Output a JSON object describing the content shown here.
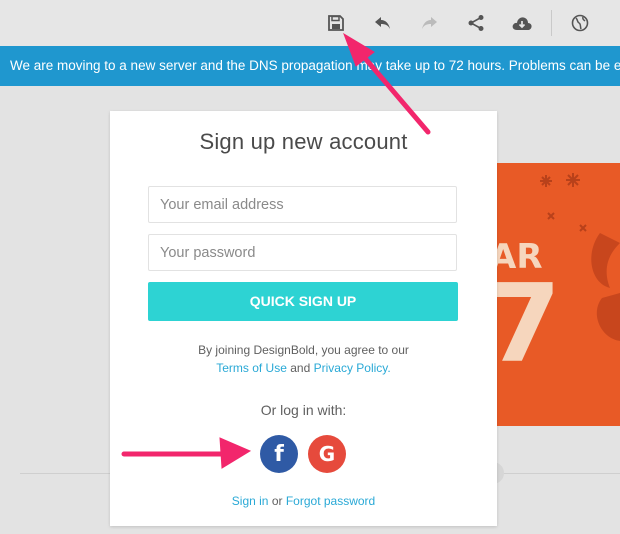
{
  "toolbar": {
    "icons": [
      "save-icon",
      "undo-icon",
      "redo-icon",
      "share-icon",
      "cloud-download-icon",
      "globe-icon"
    ]
  },
  "banner": {
    "text": "We are moving to a new server and the DNS propagation may take up to 72 hours. Problems can be ex"
  },
  "poster": {
    "text1": "AR",
    "text2": "7"
  },
  "modal": {
    "title": "Sign up new account",
    "email_placeholder": "Your email address",
    "password_placeholder": "Your password",
    "signup_label": "QUICK SIGN UP",
    "terms_prefix": "By joining DesignBold, you agree to our",
    "terms_link": "Terms of Use",
    "terms_and": "and",
    "privacy_link": "Privacy Policy.",
    "or_log_in": "Or log in with:",
    "facebook_label": "f",
    "google_label": "G",
    "sign_in": "Sign in",
    "or": "or",
    "forgot_password": "Forgot password"
  },
  "colors": {
    "banner": "#1f97cf",
    "signup_button": "#2dd3d3",
    "link": "#2aa9d6",
    "facebook": "#2f5aa5",
    "google": "#e64a3c",
    "annotation_arrow": "#f2266c",
    "poster": "#e85a26"
  }
}
